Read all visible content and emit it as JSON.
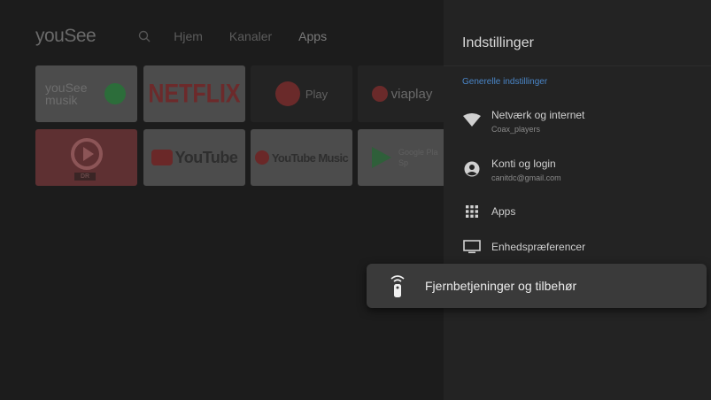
{
  "home": {
    "brand": "youSee",
    "nav": [
      "Hjem",
      "Kanaler",
      "Apps"
    ],
    "tiles": {
      "yousee_musik_line1": "youSee",
      "yousee_musik_line2": "musik",
      "netflix": "NETFLIX",
      "tv2play": "Play",
      "viaplay": "viaplay",
      "youtube": "YouTube",
      "youtube_music": "YouTube Music",
      "google_play_line1": "Google Pla",
      "google_play_line2": "Sp",
      "dr_badge": "DR"
    }
  },
  "settings": {
    "title": "Indstillinger",
    "section": "Generelle indstillinger",
    "items": [
      {
        "label": "Netværk og internet",
        "sub": "Coax_players",
        "icon": "wifi-icon"
      },
      {
        "label": "Konti og login",
        "sub": "canitdc@gmail.com",
        "icon": "account-icon"
      },
      {
        "label": "Apps",
        "icon": "apps-grid-icon"
      },
      {
        "label": "Enhedspræferencer",
        "icon": "tv-icon"
      }
    ],
    "focused": {
      "label": "Fjernbetjeninger og tilbehør",
      "icon": "remote-icon"
    }
  },
  "colors": {
    "accent": "#4a86c8",
    "panel": "#232323",
    "focus_card": "#3a3a3a"
  }
}
